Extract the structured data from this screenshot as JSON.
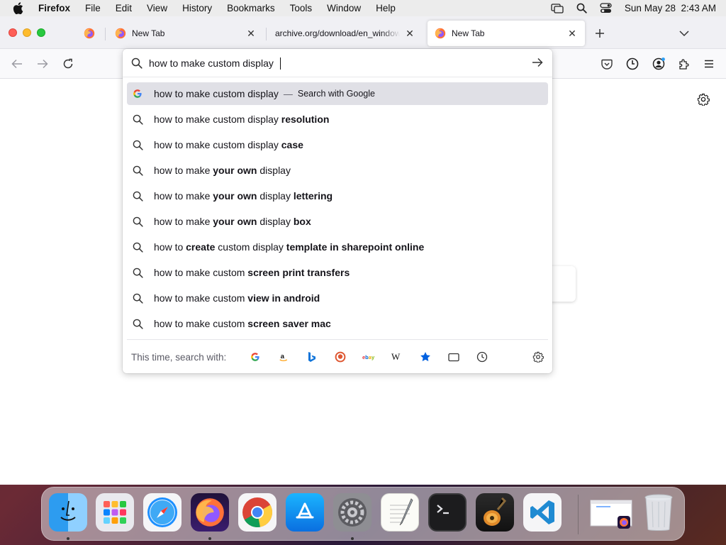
{
  "menubar": {
    "apple_icon": "apple-icon",
    "app_name": "Firefox",
    "items": [
      "File",
      "Edit",
      "View",
      "History",
      "Bookmarks",
      "Tools",
      "Window",
      "Help"
    ],
    "status_icons": [
      "screen-mirroring-icon",
      "spotlight-search-icon",
      "control-center-icon"
    ],
    "datetime": "Sun May 28  2:43 AM"
  },
  "tabs": [
    {
      "title": "New Tab",
      "favicon": "firefox-icon",
      "active": false
    },
    {
      "title": "archive.org/download/en_windows_x",
      "favicon": "none",
      "active": false
    },
    {
      "title": "New Tab",
      "favicon": "firefox-icon",
      "active": true
    }
  ],
  "urlbar": {
    "value": "how to make custom display ",
    "selected_result": {
      "text": "how to make custom display",
      "separator": "—",
      "action": "Search with Google"
    },
    "suggestions": [
      {
        "parts": [
          {
            "t": "how to make custom display ",
            "b": false
          },
          {
            "t": "resolution",
            "b": true
          }
        ]
      },
      {
        "parts": [
          {
            "t": "how to make custom display ",
            "b": false
          },
          {
            "t": "case",
            "b": true
          }
        ]
      },
      {
        "parts": [
          {
            "t": "how to make ",
            "b": false
          },
          {
            "t": "your own",
            "b": true
          },
          {
            "t": " display",
            "b": false
          }
        ]
      },
      {
        "parts": [
          {
            "t": "how to make ",
            "b": false
          },
          {
            "t": "your own",
            "b": true
          },
          {
            "t": " display ",
            "b": false
          },
          {
            "t": "lettering",
            "b": true
          }
        ]
      },
      {
        "parts": [
          {
            "t": "how to make ",
            "b": false
          },
          {
            "t": "your own",
            "b": true
          },
          {
            "t": " display ",
            "b": false
          },
          {
            "t": "box",
            "b": true
          }
        ]
      },
      {
        "parts": [
          {
            "t": "how to ",
            "b": false
          },
          {
            "t": "create",
            "b": true
          },
          {
            "t": " custom display ",
            "b": false
          },
          {
            "t": "template in sharepoint online",
            "b": true
          }
        ]
      },
      {
        "parts": [
          {
            "t": "how to make custom ",
            "b": false
          },
          {
            "t": "screen print transfers",
            "b": true
          }
        ]
      },
      {
        "parts": [
          {
            "t": "how to make custom ",
            "b": false
          },
          {
            "t": "view in android",
            "b": true
          }
        ]
      },
      {
        "parts": [
          {
            "t": "how to make custom ",
            "b": false
          },
          {
            "t": "screen saver mac",
            "b": true
          }
        ]
      }
    ],
    "oneoff_label": "This time, search with:",
    "oneoff_engines": [
      "google-icon",
      "amazon-icon",
      "bing-icon",
      "duckduckgo-icon",
      "ebay-icon",
      "wikipedia-icon",
      "bookmarks-star-icon",
      "tabs-icon",
      "history-icon",
      "search-settings-gear-icon"
    ]
  },
  "toolbar_icons": [
    "pocket-icon",
    "firefox-view-icon",
    "account-icon",
    "extensions-icon",
    "app-menu-icon"
  ],
  "dock": {
    "apps": [
      "finder-icon",
      "launchpad-icon",
      "safari-icon",
      "firefox-icon",
      "chrome-icon",
      "app-store-icon",
      "system-preferences-icon",
      "textedit-icon",
      "terminal-icon",
      "garageband-icon",
      "vscode-icon",
      "window-preview-icon",
      "trash-icon"
    ]
  },
  "colors": {
    "menubar_bg": "#ececec",
    "tabstrip_bg": "#f0f0f4",
    "selected_row_bg": "#e0e0e6",
    "accent_blue": "#0061e0"
  }
}
